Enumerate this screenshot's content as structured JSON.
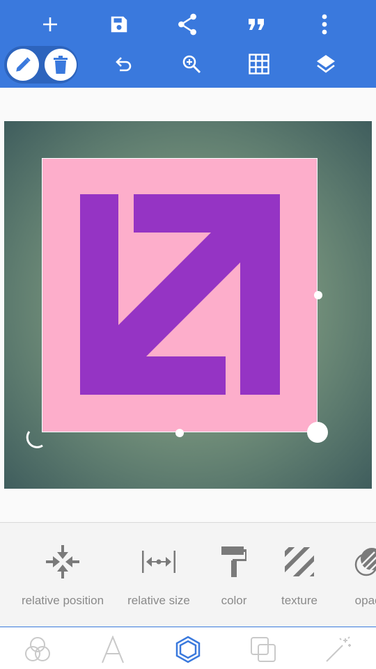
{
  "colors": {
    "toolbar": "#3a79dd",
    "toolbar_group": "#2d64bd",
    "layer_fill": "#fdaecb",
    "shape_fill": "#9534c4",
    "nav_active": "#3a79dd",
    "nav_inactive": "#c9c9c9",
    "tool_icon": "#7a7a7a",
    "tool_label": "#8a8a8a"
  },
  "toolbar": {
    "row1": [
      "plus-icon",
      "save-icon",
      "share-icon",
      "quote-icon",
      "more-vert-icon"
    ],
    "row2": [
      "pencil-icon",
      "trash-icon",
      "undo-icon",
      "zoom-in-icon",
      "grid-icon",
      "layers-icon"
    ]
  },
  "canvas": {
    "background": "radial vignette green-grey",
    "layer_shape": "arrows-diagonal-icon"
  },
  "tools": [
    {
      "label": "relative position",
      "icon": "relative-position-icon"
    },
    {
      "label": "relative size",
      "icon": "relative-size-icon"
    },
    {
      "label": "color",
      "icon": "paint-roller-icon"
    },
    {
      "label": "texture",
      "icon": "texture-stripes-icon"
    },
    {
      "label": "opaci",
      "icon": "opacity-icon"
    }
  ],
  "nav": {
    "items": [
      "blend-circles-icon",
      "text-icon",
      "shape-hexagon-icon",
      "layers-squares-icon",
      "magic-wand-icon"
    ],
    "active_index": 2
  }
}
